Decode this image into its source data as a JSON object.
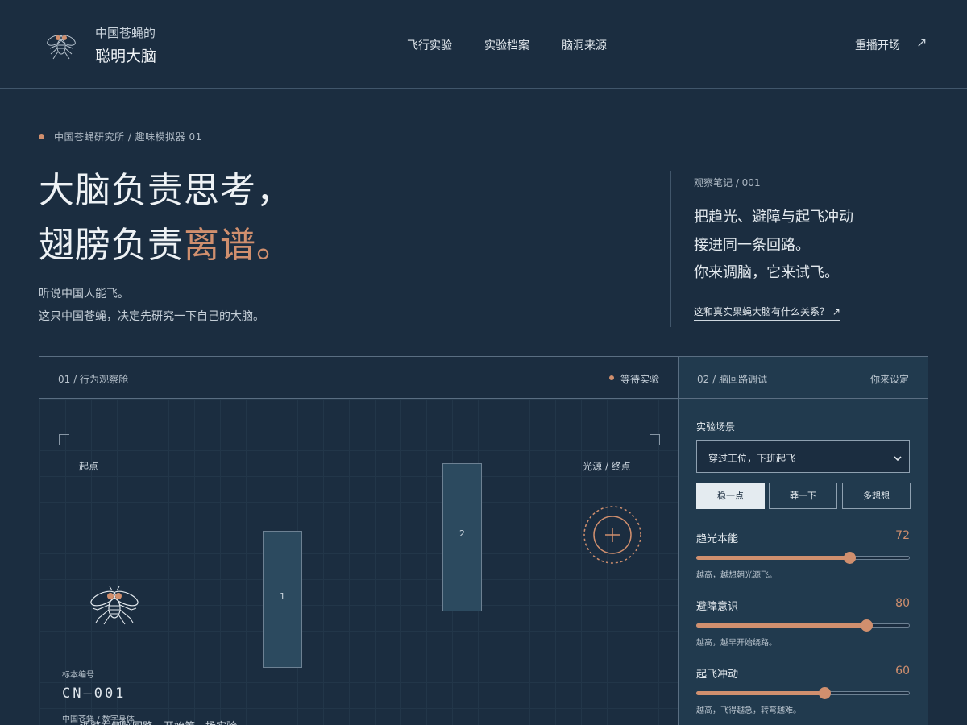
{
  "brand": {
    "line1": "中国苍蝇的",
    "line2": "聪明大脑",
    "logo_icon": "fly-icon"
  },
  "nav": {
    "items": [
      "飞行实验",
      "实验档案",
      "脑洞来源"
    ],
    "replay_label": "重播开场",
    "replay_icon": "arrow-up-right-icon"
  },
  "hero": {
    "breadcrumb": "中国苍蝇研究所 / 趣味模拟器 01",
    "title_line1": "大脑负责思考，",
    "title_line2_prefix": "翅膀负责",
    "title_line2_accent": "离谱",
    "title_line2_suffix": "。",
    "subtitle_1": "听说中国人能飞。",
    "subtitle_2": "这只中国苍蝇，决定先研究一下自己的大脑。"
  },
  "note": {
    "label": "观察笔记 / 001",
    "lines": [
      "把趋光、避障与起飞冲动",
      "接进同一条回路。",
      "你来调脑，它来试飞。"
    ],
    "link": "这和真实果蝇大脑有什么关系？ ↗"
  },
  "observation": {
    "header": "01 / 行为观察舱",
    "status": "等待实验",
    "start_label": "起点",
    "end_label": "光源 / 终点",
    "obstacles": [
      "1",
      "2"
    ],
    "specimen_label": "标本编号",
    "specimen_id": "CN—001",
    "specimen_sub": "中国苍蝇 / 数字身体",
    "hint": "调整右侧脑回路，开始第一场实验。"
  },
  "debug": {
    "header": "02 / 脑回路调试",
    "header_right": "你来设定",
    "scene_label": "实验场景",
    "scene_value": "穿过工位，下班起飞",
    "modes": [
      "稳一点",
      "莽一下",
      "多想想"
    ],
    "active_mode": "稳一点",
    "sliders": [
      {
        "label": "趋光本能",
        "value": 72,
        "desc": "越高，越想朝光源飞。"
      },
      {
        "label": "避障意识",
        "value": 80,
        "desc": "越高，越早开始绕路。"
      },
      {
        "label": "起飞冲动",
        "value": 60,
        "desc": "越高，飞得越急，转弯越难。"
      }
    ]
  },
  "colors": {
    "background": "#1b2d40",
    "accent": "#d08f6e",
    "panel": "#213a4e"
  }
}
